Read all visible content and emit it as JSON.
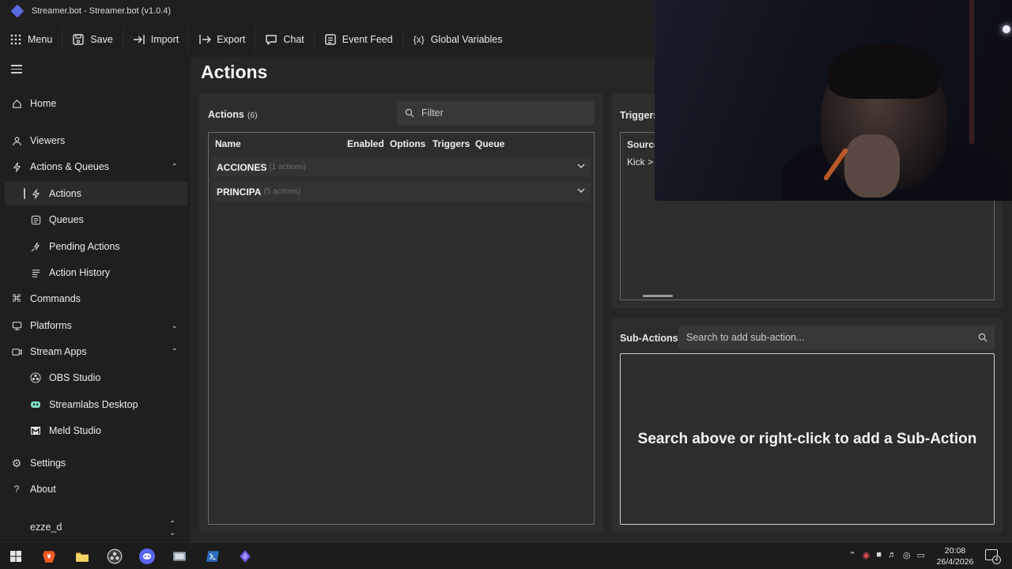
{
  "window": {
    "title": "Streamer.bot - Streamer.bot (v1.0.4)"
  },
  "toolbar": {
    "items": [
      {
        "label": "Menu",
        "icon": "grid-dots-icon"
      },
      {
        "label": "Save",
        "icon": "save-icon"
      },
      {
        "label": "Import",
        "icon": "import-icon"
      },
      {
        "label": "Export",
        "icon": "export-icon"
      },
      {
        "label": "Chat",
        "icon": "chat-icon"
      },
      {
        "label": "Event Feed",
        "icon": "event-feed-icon"
      },
      {
        "label": "Global Variables",
        "icon": "variables-icon"
      }
    ]
  },
  "sidebar": {
    "items": [
      {
        "label": "Home",
        "icon": "home-icon"
      },
      {
        "label": "Viewers",
        "icon": "user-icon"
      },
      {
        "label": "Actions & Queues",
        "icon": "bolt-icon",
        "chevron": "^"
      },
      {
        "label": "Actions",
        "icon": "bolt-icon"
      },
      {
        "label": "Queues",
        "icon": "list-icon"
      },
      {
        "label": "Pending Actions",
        "icon": "pending-icon"
      },
      {
        "label": "Action History",
        "icon": "history-icon"
      },
      {
        "label": "Commands",
        "icon": "command-icon"
      },
      {
        "label": "Platforms",
        "icon": "platform-icon",
        "chevron": "v"
      },
      {
        "label": "Stream Apps",
        "icon": "stream-apps-icon",
        "chevron": "^"
      },
      {
        "label": "OBS Studio",
        "icon": "obs-icon"
      },
      {
        "label": "Streamlabs Desktop",
        "icon": "streamlabs-icon"
      },
      {
        "label": "Meld Studio",
        "icon": "meld-icon"
      },
      {
        "label": "Settings",
        "icon": "gear-icon"
      },
      {
        "label": "About",
        "icon": "question-icon"
      }
    ],
    "user": "ezze_d"
  },
  "main": {
    "title": "Actions",
    "actions": {
      "heading": "Actions",
      "count": "(6)",
      "filter_placeholder": "Filter",
      "columns": [
        "Name",
        "Enabled",
        "Options",
        "Triggers",
        "Queue"
      ],
      "groups": [
        {
          "name": "ACCIONES",
          "count": "(1 actions)"
        },
        {
          "name": "PRINCIPA",
          "count": "(5 actions)"
        }
      ]
    },
    "triggers": {
      "heading": "Triggers",
      "column": "Source",
      "row": "Kick > "
    },
    "sub_actions": {
      "heading": "Sub-Actions",
      "search_placeholder": "Search to add sub-action...",
      "empty_message": "Search above or right-click to add a Sub-Action"
    }
  },
  "taskbar": {
    "time": "20:08",
    "date": "26/4/2026",
    "notifications": "4"
  }
}
